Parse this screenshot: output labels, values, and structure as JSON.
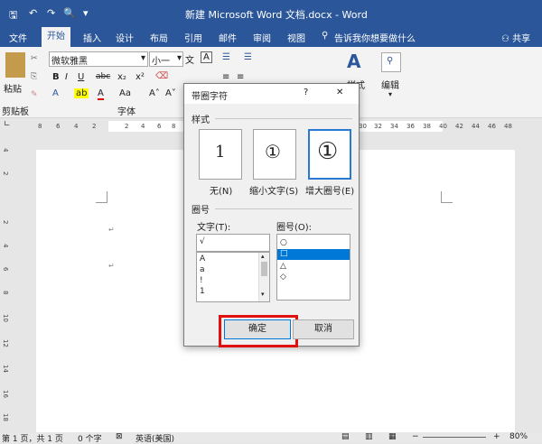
{
  "titlebar": {
    "title": "新建 Microsoft Word 文档.docx - Word",
    "restore_icon": "restore-icon",
    "minimize_icon": "minimize-icon"
  },
  "menu": {
    "items": [
      "文件",
      "开始",
      "插入",
      "设计",
      "布局",
      "引用",
      "邮件",
      "审阅",
      "视图"
    ],
    "active": "开始",
    "tellme": "告诉我你想要做什么",
    "share": "共享"
  },
  "ribbon": {
    "paste": "粘贴",
    "clipboard": "剪贴板",
    "font_name": "微软雅黑",
    "font_size": "小一",
    "font_group": "字体",
    "style_label": "样式",
    "edit_label": "编辑",
    "bold": "B",
    "italic": "I",
    "underline": "U",
    "strike": "abc",
    "sub": "x₂",
    "sup": "x²",
    "wen": "文",
    "aa": "Aa",
    "grow": "A˄",
    "shrink": "A˅",
    "boxA": "A"
  },
  "ruler": {
    "ticks": [
      "8",
      "6",
      "4",
      "2",
      "2",
      "4",
      "6",
      "8",
      "30",
      "32",
      "34",
      "36",
      "38",
      "40",
      "42",
      "44",
      "46",
      "48"
    ],
    "vticks": [
      "4",
      "2",
      "2",
      "4",
      "6",
      "8",
      "10",
      "12",
      "14",
      "16",
      "18"
    ]
  },
  "dialog": {
    "title": "带圈字符",
    "help": "?",
    "close": "✕",
    "style_group": "样式",
    "styles": [
      {
        "glyph": "1",
        "label": "无(N)"
      },
      {
        "glyph": "①",
        "label": "缩小文字(S)"
      },
      {
        "glyph": "①",
        "label": "增大圈号(E)"
      }
    ],
    "circle_group": "圈号",
    "text_label": "文字(T):",
    "text_value": "√",
    "text_list": [
      "A",
      "a",
      "!",
      "1"
    ],
    "circle_label": "圈号(O):",
    "circle_list": [
      "○",
      "□",
      "△",
      "◇"
    ],
    "ok": "确定",
    "cancel": "取消"
  },
  "status": {
    "page": "第 1 页，共 1 页",
    "words": "0 个字",
    "lang": "英语(美国)",
    "zoom": "80%"
  }
}
